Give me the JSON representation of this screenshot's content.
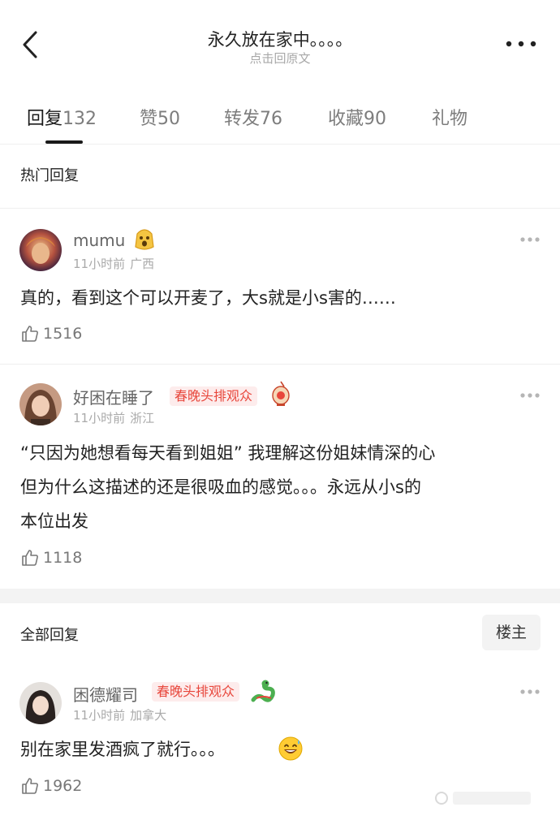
{
  "header": {
    "title": "永久放在家中。。。。",
    "subtitle": "点击回原文"
  },
  "tabs": [
    {
      "label": "回复",
      "count": "132"
    },
    {
      "label": "赞",
      "count": "50"
    },
    {
      "label": "转发",
      "count": "76"
    },
    {
      "label": "收藏",
      "count": "90"
    },
    {
      "label": "礼物",
      "count": ""
    }
  ],
  "hot": {
    "title": "热门回复",
    "comments": [
      {
        "user": "mumu",
        "time": "11小时前",
        "location": "广西",
        "text": "真的，看到这个可以开麦了，大s就是小s害的……",
        "likes": "1516"
      },
      {
        "user": "好困在睡了",
        "badge": "春晚头排观众",
        "time": "11小时前",
        "location": "浙江",
        "text_lines": [
          "“只因为她想看每天看到姐姐” 我理解这份姐妹情深的心",
          "但为什么这描述的还是很吸血的感觉。。。永远从小s的",
          "本位出发"
        ],
        "likes": "1118"
      }
    ]
  },
  "all": {
    "title": "全部回复",
    "filter_label": "楼主",
    "comments": [
      {
        "user": "困德耀司",
        "badge": "春晚头排观众",
        "time": "11小时前",
        "location": "加拿大",
        "text": "别在家里发酒疯了就行。。。",
        "likes": "1962"
      }
    ]
  },
  "colors": {
    "badge_bg": "#fdecec",
    "badge_text": "#e8463b",
    "muted": "#aaaaaa"
  }
}
